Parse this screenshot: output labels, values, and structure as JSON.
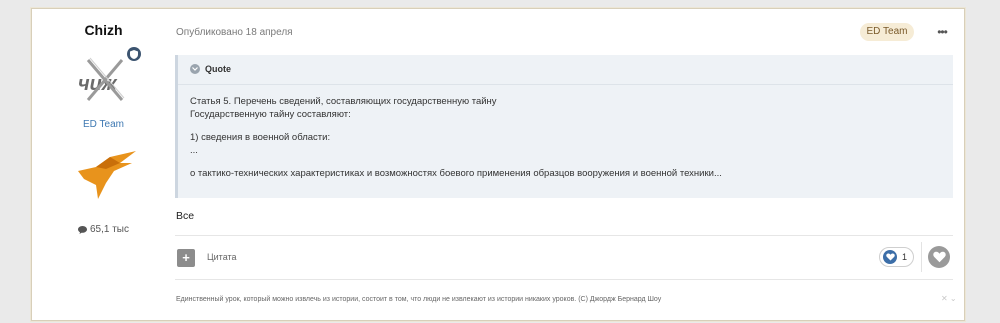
{
  "author": {
    "name": "Chizh",
    "avatar_icon": "avatar-crossed-logo-icon",
    "badge_icon": "shield-icon",
    "group": "ED Team",
    "rank_icon": "orange-bird-rank-icon",
    "post_count": "65,1 тыс",
    "post_count_icon": "comment-icon"
  },
  "post": {
    "published": "Опубликовано 18 апреля",
    "badge": "ED Team",
    "more_icon": "more-dots-icon",
    "more_label": "•••",
    "quote": {
      "title": "Quote",
      "toggle_icon": "chevron-down-icon",
      "lines": [
        "Статья 5. Перечень сведений, составляющих государственную тайну",
        "Государственную тайну составляют:",
        "1) сведения в военной области:",
        "...",
        "о тактико-технических характеристиках и возможностях боевого применения образцов вооружения и военной техники..."
      ]
    },
    "text": "Все",
    "actions": {
      "plus_icon": "plus-icon",
      "plus_label": "+",
      "quote_label": "Цитата",
      "reaction_icon": "heart-reaction-icon",
      "reaction_count": "1",
      "like_icon": "heart-icon"
    },
    "signature": "Единственный урок, который можно извлечь из истории, состоит в том, что люди не извлекают из истории никаких уроков. (С) Джордж Бернард Шоу",
    "signature_controls": "✕ ⌄"
  },
  "colors": {
    "accent": "#3e78b2",
    "badge_bg": "#f6ecd6",
    "quote_bg": "#eef2f6",
    "rank_orange": "#e8931c"
  }
}
